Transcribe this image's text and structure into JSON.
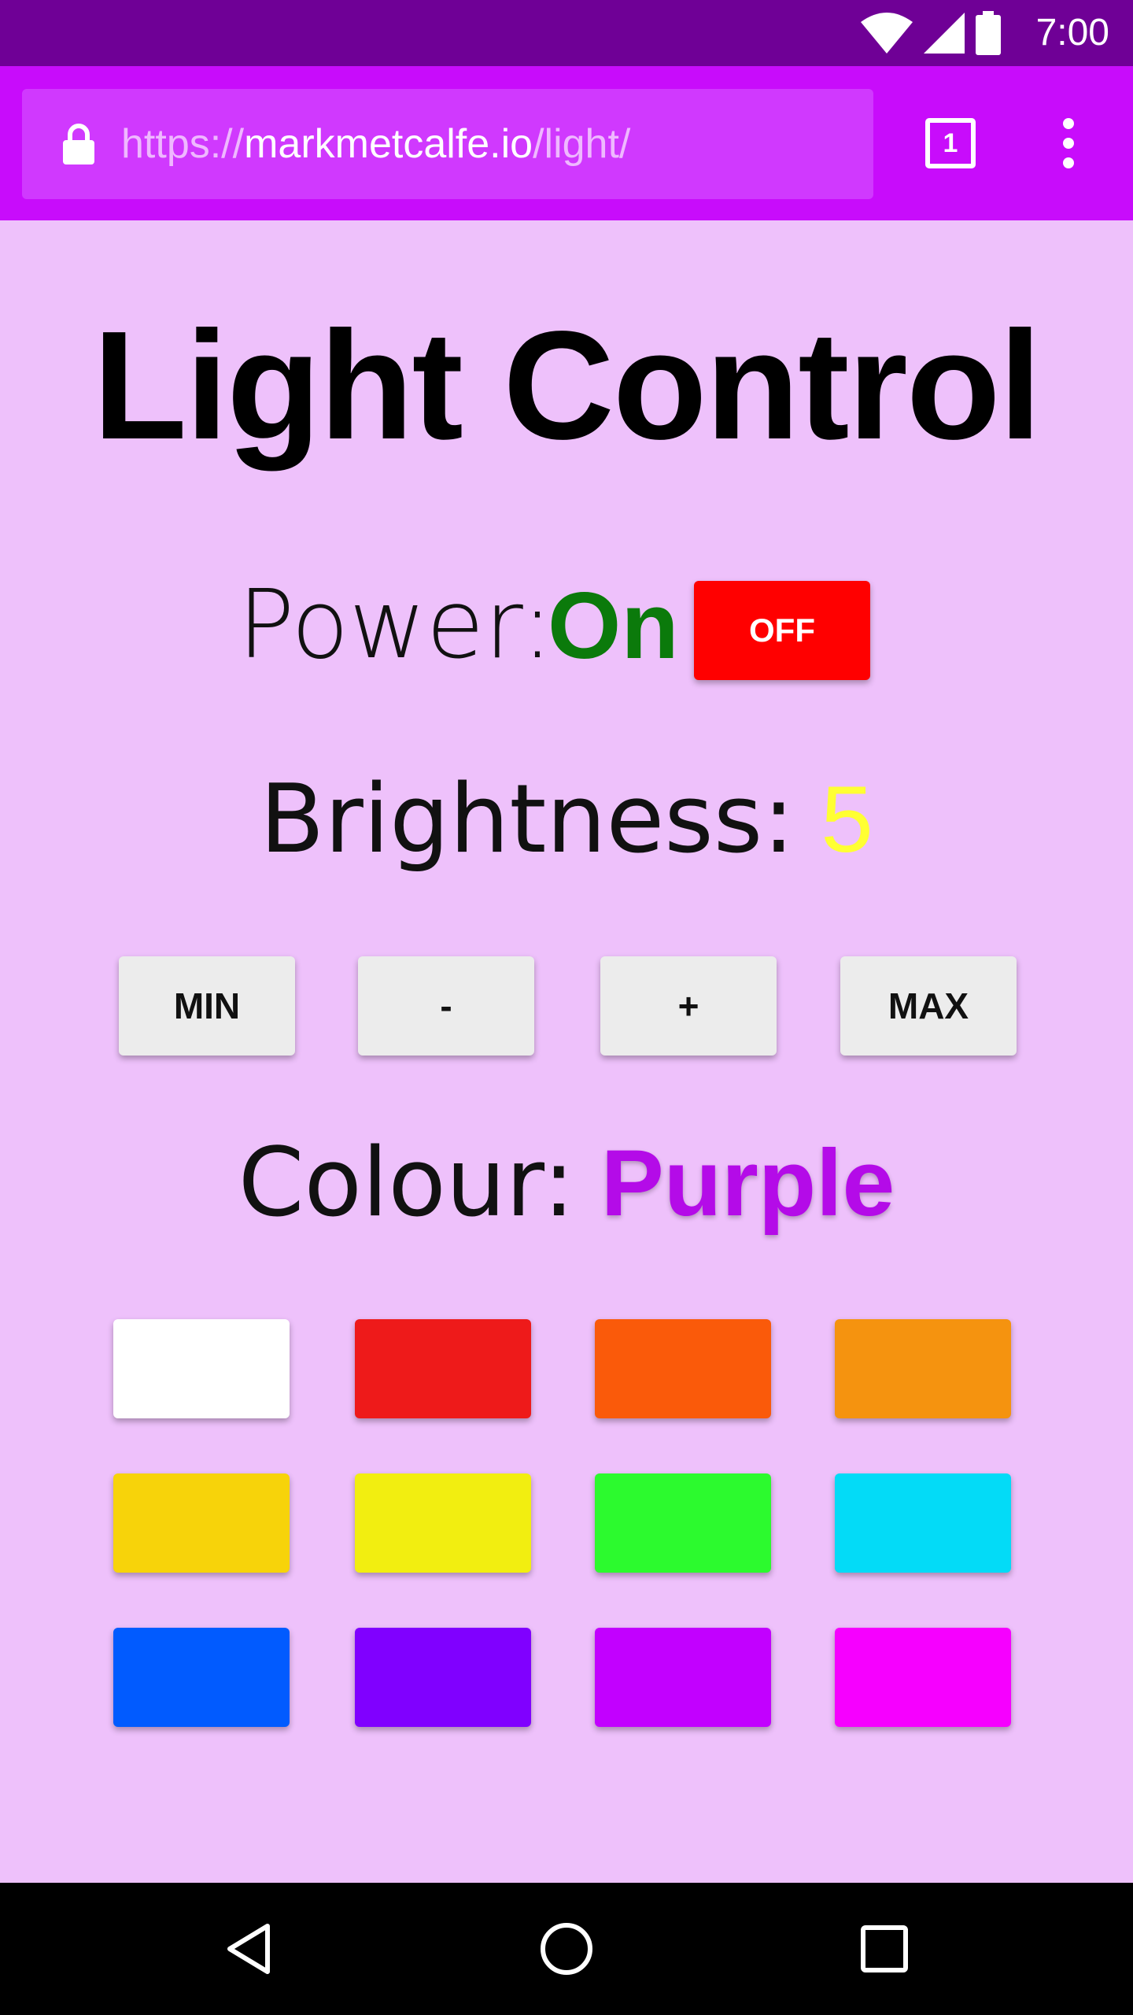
{
  "status_bar": {
    "time": "7:00",
    "icons": [
      "wifi-icon",
      "signal-icon",
      "battery-icon"
    ]
  },
  "browser": {
    "url_scheme": "https://",
    "url_host": "markmetcalfe.io",
    "url_path": "/light/",
    "tab_count": "1",
    "icons": [
      "lock-icon",
      "tabs-icon",
      "more-vert-icon"
    ]
  },
  "page": {
    "title": "Light Control",
    "power": {
      "label": "Power:",
      "value": "On",
      "value_color": "#0b7a0b",
      "toggle_label": "OFF",
      "toggle_color": "#ff0000"
    },
    "brightness": {
      "label": "Brightness:",
      "value": "5",
      "value_color": "#ffff33",
      "buttons": [
        "MIN",
        "-",
        "+",
        "MAX"
      ]
    },
    "colour": {
      "label": "Colour:",
      "value": "Purple",
      "value_color": "#b40be8",
      "swatches": [
        "#ffffff",
        "#ee1a1a",
        "#fa5a0a",
        "#f5930f",
        "#f7d30a",
        "#f2ee10",
        "#2cfa2e",
        "#03dbf7",
        "#015bff",
        "#8000ff",
        "#c200ff",
        "#f600ff"
      ]
    }
  },
  "nav_bar": {
    "icons": [
      "back-icon",
      "home-icon",
      "recents-icon"
    ]
  },
  "theme": {
    "status_bar_color": "#6f0096",
    "toolbar_color": "#c80cfb",
    "page_background": "#eec1fb"
  }
}
